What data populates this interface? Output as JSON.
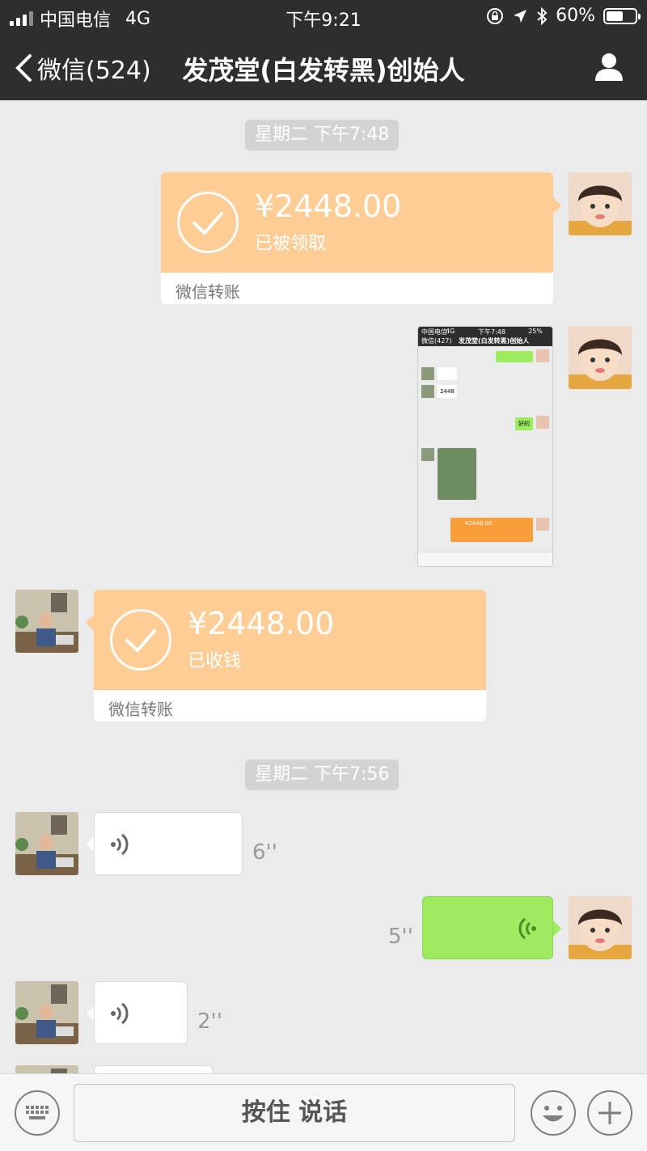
{
  "status_bar": {
    "carrier": "中国电信",
    "network": "4G",
    "time": "下午9:21",
    "battery": "60%",
    "battery_level": 0.6
  },
  "nav": {
    "back_label": "微信(524)",
    "title": "发茂堂(白发转黑)创始人"
  },
  "messages": [
    {
      "type": "timestamp",
      "text": "星期二 下午7:48"
    },
    {
      "type": "transfer",
      "side": "right",
      "amount": "¥2448.00",
      "status": "已被领取",
      "footer": "微信转账"
    },
    {
      "type": "image",
      "side": "right",
      "description": "screenshot"
    },
    {
      "type": "transfer",
      "side": "left",
      "amount": "¥2448.00",
      "status": "已收钱",
      "footer": "微信转账"
    },
    {
      "type": "timestamp",
      "text": "星期二 下午7:56"
    },
    {
      "type": "voice",
      "side": "left",
      "duration": "6''"
    },
    {
      "type": "voice",
      "side": "right",
      "duration": "5''"
    },
    {
      "type": "voice",
      "side": "left",
      "duration": "2''"
    }
  ],
  "thumbnail": {
    "back_label": "微信(427)",
    "title": "发茂堂(白发转黑)创始人",
    "status_time": "下午7:48",
    "status_carrier": "中国电信",
    "status_network": "4G",
    "status_battery": "25%",
    "amount_text": "2448",
    "ok_text": "好的",
    "transfer_amount": "¥2448.00"
  },
  "input_bar": {
    "hold_to_talk": "按住 说话"
  }
}
